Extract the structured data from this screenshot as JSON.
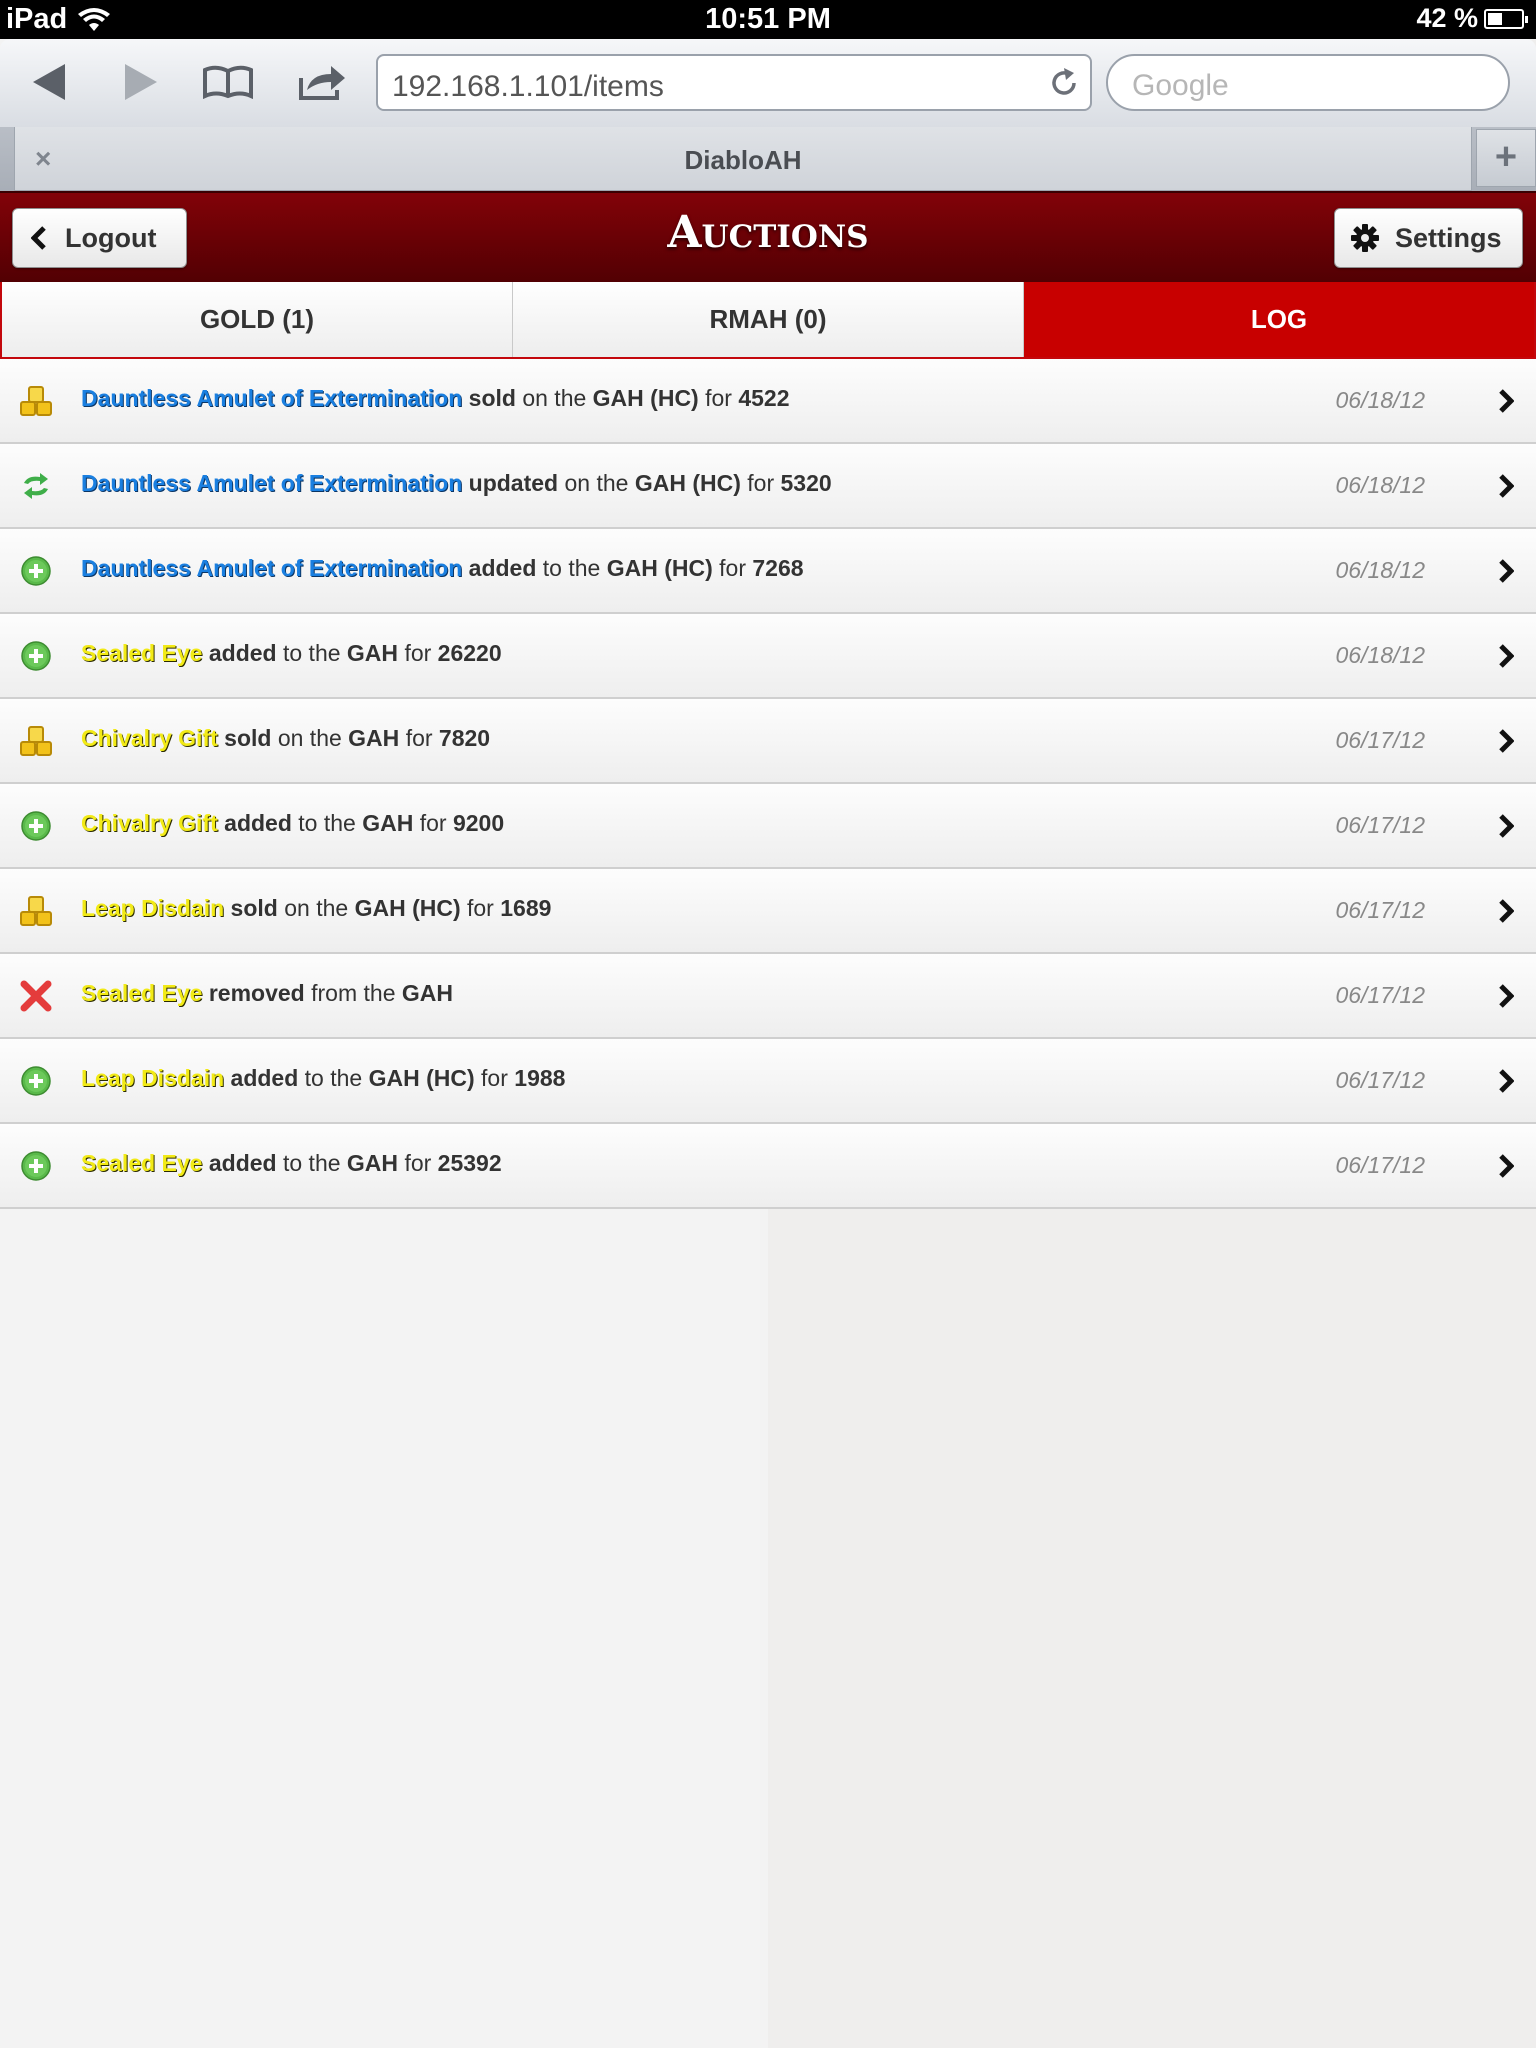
{
  "status_bar": {
    "device": "iPad",
    "time": "10:51 PM",
    "battery": "42 %"
  },
  "browser": {
    "url": "192.168.1.101/items",
    "search_placeholder": "Google",
    "tab_title": "DiabloAH",
    "tab_close": "×",
    "new_tab": "+"
  },
  "header": {
    "title": "Auctions",
    "logout_label": "Logout",
    "settings_label": "Settings"
  },
  "tabs": [
    {
      "label": "GOLD (1)",
      "active": false
    },
    {
      "label": "RMAH (0)",
      "active": false
    },
    {
      "label": "LOG",
      "active": true
    }
  ],
  "log": [
    {
      "icon": "coins-icon",
      "item": "Dauntless Amulet of Extermination",
      "item_color": "blue",
      "action": "sold",
      "prep": "on the",
      "house": "GAH (HC)",
      "for_label": "for",
      "price": "4522",
      "date": "06/18/12"
    },
    {
      "icon": "update-icon",
      "item": "Dauntless Amulet of Extermination",
      "item_color": "blue",
      "action": "updated",
      "prep": "on the",
      "house": "GAH (HC)",
      "for_label": "for",
      "price": "5320",
      "date": "06/18/12"
    },
    {
      "icon": "add-icon",
      "item": "Dauntless Amulet of Extermination",
      "item_color": "blue",
      "action": "added",
      "prep": "to the",
      "house": "GAH (HC)",
      "for_label": "for",
      "price": "7268",
      "date": "06/18/12"
    },
    {
      "icon": "add-icon",
      "item": "Sealed Eye",
      "item_color": "yellow",
      "action": "added",
      "prep": "to the",
      "house": "GAH",
      "for_label": "for",
      "price": "26220",
      "date": "06/18/12"
    },
    {
      "icon": "coins-icon",
      "item": "Chivalry Gift",
      "item_color": "yellow",
      "action": "sold",
      "prep": "on the",
      "house": "GAH",
      "for_label": "for",
      "price": "7820",
      "date": "06/17/12"
    },
    {
      "icon": "add-icon",
      "item": "Chivalry Gift",
      "item_color": "yellow",
      "action": "added",
      "prep": "to the",
      "house": "GAH",
      "for_label": "for",
      "price": "9200",
      "date": "06/17/12"
    },
    {
      "icon": "coins-icon",
      "item": "Leap Disdain",
      "item_color": "yellow",
      "action": "sold",
      "prep": "on the",
      "house": "GAH (HC)",
      "for_label": "for",
      "price": "1689",
      "date": "06/17/12"
    },
    {
      "icon": "remove-icon",
      "item": "Sealed Eye",
      "item_color": "yellow",
      "action": "removed",
      "prep": "from the",
      "house": "GAH",
      "for_label": "",
      "price": "",
      "date": "06/17/12"
    },
    {
      "icon": "add-icon",
      "item": "Leap Disdain",
      "item_color": "yellow",
      "action": "added",
      "prep": "to the",
      "house": "GAH (HC)",
      "for_label": "for",
      "price": "1988",
      "date": "06/17/12"
    },
    {
      "icon": "add-icon",
      "item": "Sealed Eye",
      "item_color": "yellow",
      "action": "added",
      "prep": "to the",
      "house": "GAH",
      "for_label": "for",
      "price": "25392",
      "date": "06/17/12"
    }
  ],
  "colors": {
    "header_red": "#820208",
    "active_tab": "#c80000",
    "item_blue": "#1a7fe0",
    "item_yellow": "#f2ea16"
  }
}
